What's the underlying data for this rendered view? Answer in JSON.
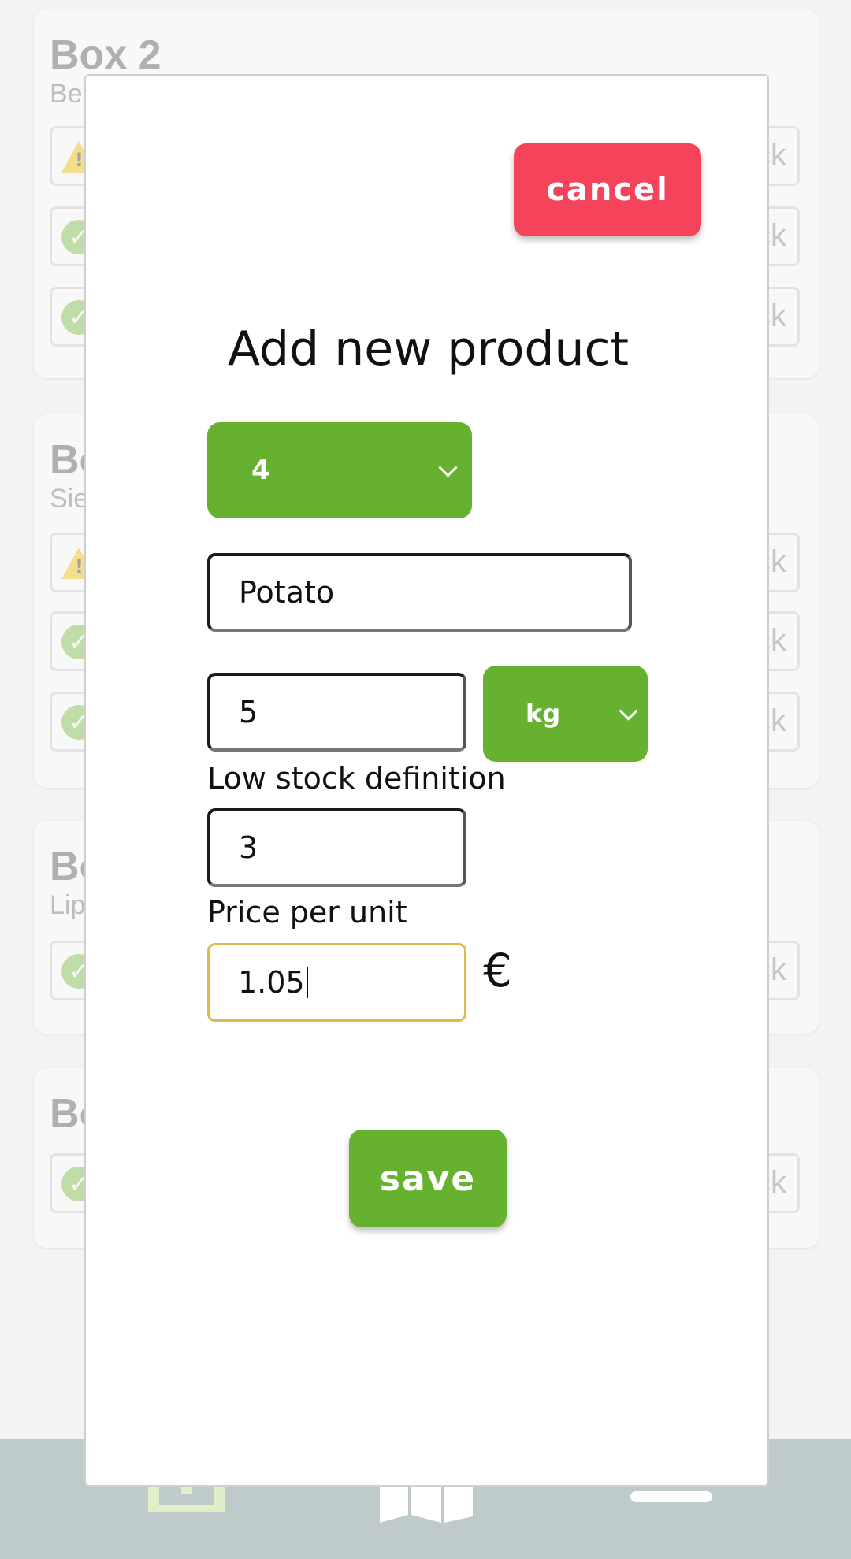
{
  "background": {
    "boxes": [
      {
        "title": "Box 2",
        "subtitle": "Be",
        "items": [
          "warn",
          "ok",
          "ok"
        ],
        "action": "ck"
      },
      {
        "title": "Bo",
        "subtitle": "Sie",
        "items": [
          "warn",
          "ok",
          "ok"
        ],
        "action": "ck"
      },
      {
        "title": "Bo",
        "subtitle": "Lip",
        "items": [
          "ok"
        ],
        "action": "ck"
      },
      {
        "title": "Bo",
        "subtitle": "",
        "items": [
          "ok"
        ],
        "action": "ck"
      }
    ]
  },
  "modal": {
    "cancel_label": "cancel",
    "title": "Add new product",
    "category_value": "4",
    "name_value": "Potato",
    "quantity_value": "5",
    "unit_value": "kg",
    "low_stock_label": "Low stock definition",
    "low_stock_value": "3",
    "price_label": "Price per unit",
    "price_value": "1.05",
    "currency": "€",
    "save_label": "save"
  },
  "bottom_nav": {
    "icons": [
      "shelf-icon",
      "map-icon",
      "menu-icon"
    ]
  },
  "colors": {
    "accent_green": "#66b230",
    "cancel_red": "#f4435b",
    "nav_bg": "#bfcaca"
  }
}
